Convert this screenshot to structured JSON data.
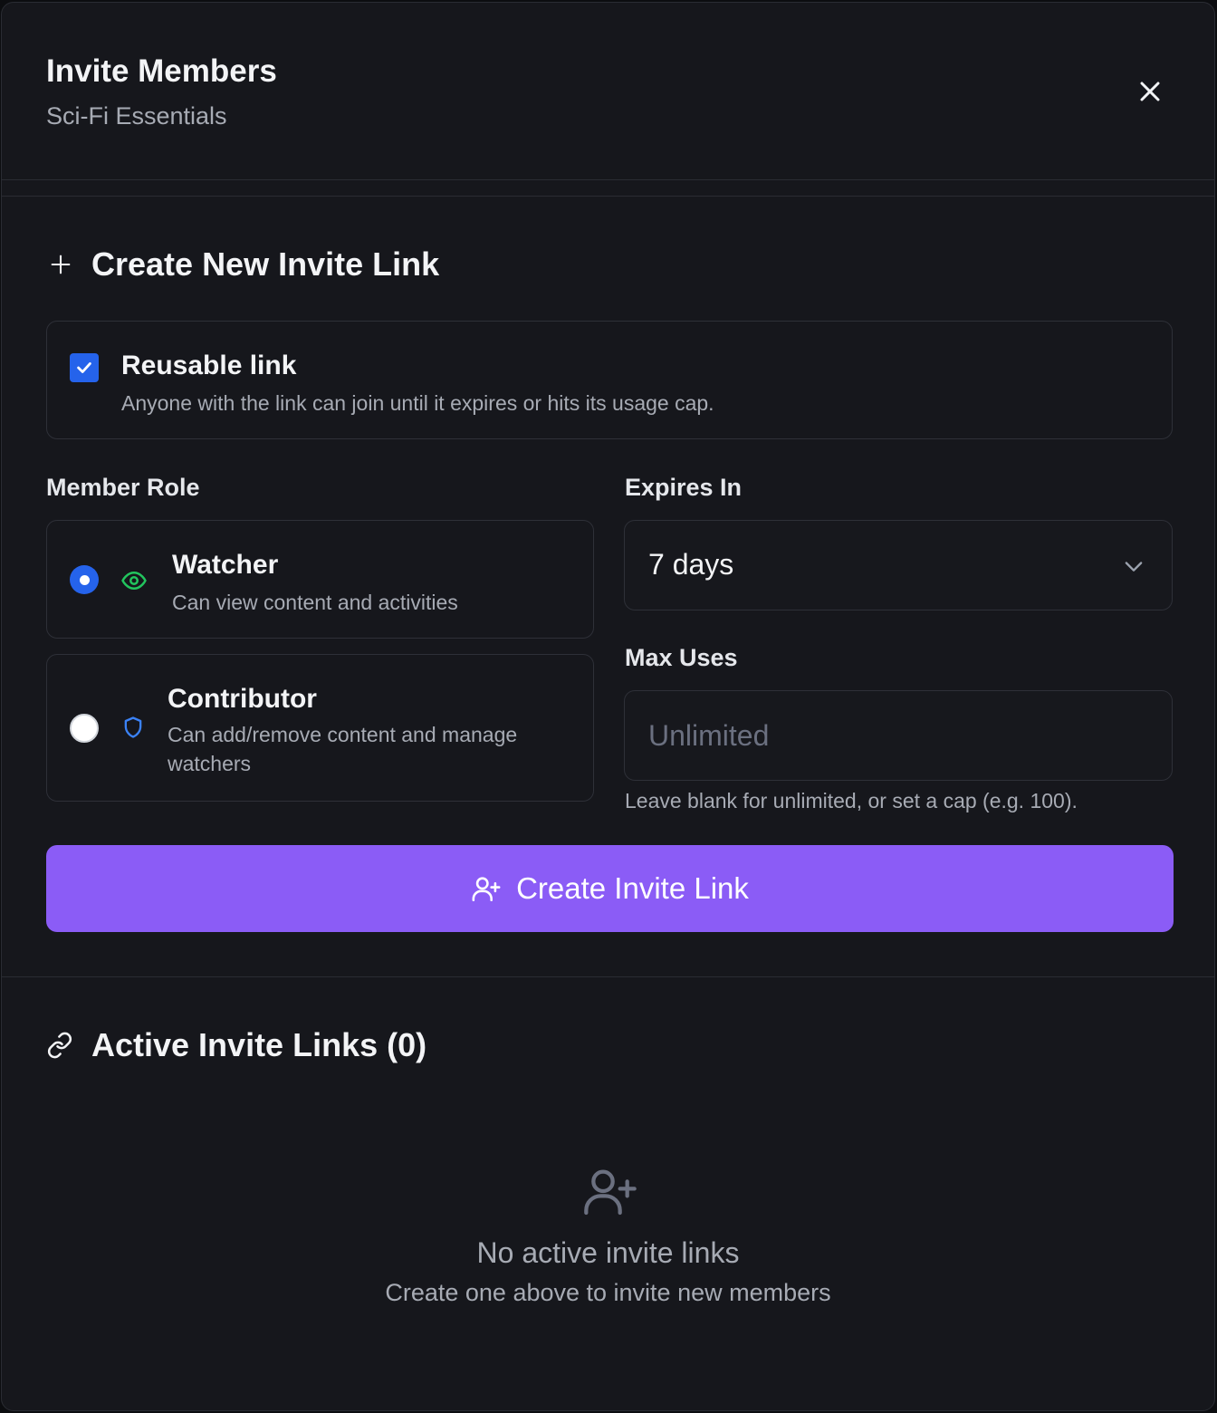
{
  "header": {
    "title": "Invite Members",
    "subtitle": "Sci-Fi Essentials"
  },
  "create_section": {
    "title": "Create New Invite Link",
    "reusable": {
      "checked": true,
      "label": "Reusable link",
      "description": "Anyone with the link can join until it expires or hits its usage cap."
    },
    "member_role": {
      "label": "Member Role",
      "options": [
        {
          "label": "Watcher",
          "description": "Can view content and activities",
          "selected": true,
          "icon": "eye-icon",
          "icon_color": "#22c55e"
        },
        {
          "label": "Contributor",
          "description": "Can add/remove content and manage watchers",
          "selected": false,
          "icon": "shield-icon",
          "icon_color": "#3b82f6"
        }
      ]
    },
    "expires": {
      "label": "Expires In",
      "value": "7 days"
    },
    "max_uses": {
      "label": "Max Uses",
      "placeholder": "Unlimited",
      "help": "Leave blank for unlimited, or set a cap (e.g. 100)."
    },
    "button_label": "Create Invite Link"
  },
  "active_section": {
    "title": "Active Invite Links (0)",
    "empty_title": "No active invite links",
    "empty_subtitle": "Create one above to invite new members"
  },
  "colors": {
    "accent": "#8b5cf6",
    "primary_blue": "#2563eb",
    "background": "#16171c"
  }
}
